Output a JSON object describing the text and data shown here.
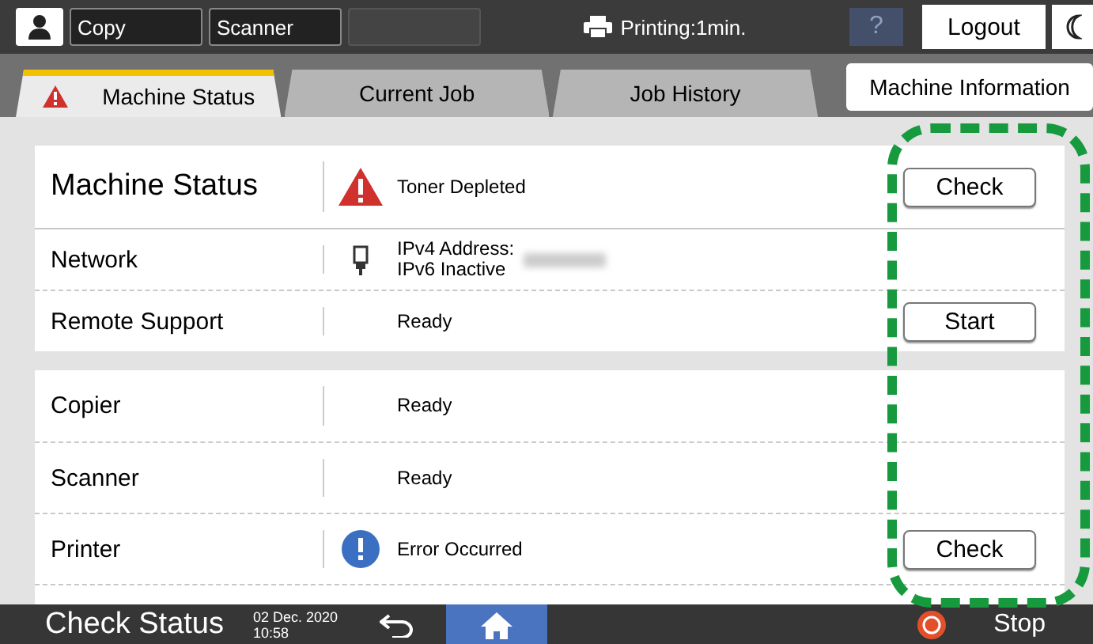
{
  "top_bar": {
    "function_keys": [
      "Copy",
      "Scanner"
    ],
    "status": "Printing:1min.",
    "help": "?",
    "logout": "Logout"
  },
  "tabs": [
    {
      "label": "Machine Status",
      "selected": true,
      "warning": true,
      "kind": "folder"
    },
    {
      "label": "Current Job",
      "selected": false,
      "warning": false,
      "kind": "folder"
    },
    {
      "label": "Job History",
      "selected": false,
      "warning": false,
      "kind": "folder"
    },
    {
      "label": "Machine Information",
      "selected": false,
      "warning": false,
      "kind": "button"
    }
  ],
  "sections": [
    {
      "rows": [
        {
          "label": "Machine Status",
          "kind": "header",
          "warning": true,
          "error": false,
          "status": [
            "Toner Depleted"
          ],
          "button": "Check"
        },
        {
          "label": "Network",
          "kind": "network",
          "warning": false,
          "error": false,
          "status": [
            "IPv4 Address:",
            "IPv6 Inactive"
          ],
          "redacted": true
        },
        {
          "label": "Remote Support",
          "kind": "item",
          "warning": false,
          "error": false,
          "status": [
            "Ready"
          ],
          "button": "Start"
        }
      ]
    },
    {
      "rows": [
        {
          "label": "Copier",
          "kind": "item",
          "warning": false,
          "error": false,
          "status": [
            "Ready"
          ]
        },
        {
          "label": "Scanner",
          "kind": "item",
          "warning": false,
          "error": false,
          "status": [
            "Ready"
          ]
        },
        {
          "label": "Printer",
          "kind": "item",
          "warning": false,
          "error": true,
          "status": [
            "Error Occurred"
          ],
          "button": "Check"
        }
      ]
    }
  ],
  "bottom_bar": {
    "title": "Check Status",
    "date": "02 Dec. 2020",
    "time": "10:58",
    "home_selected": true,
    "stop": "Stop"
  },
  "highlight": true
}
